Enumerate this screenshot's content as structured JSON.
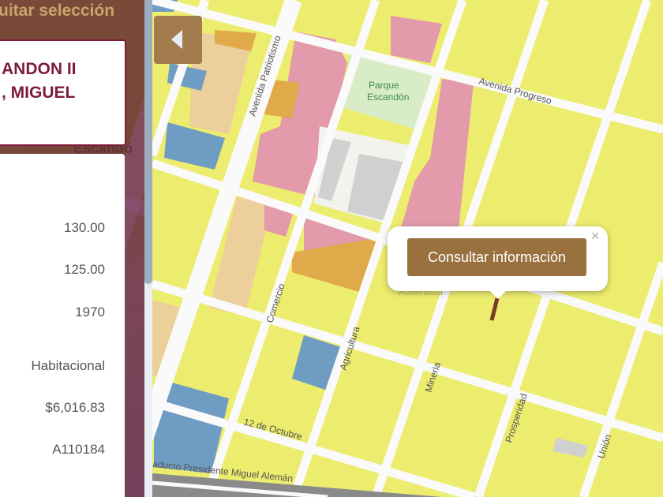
{
  "sidebar": {
    "quit_selection": "uitar selección",
    "name_line1": "ANDON II",
    "name_line2": ", MIGUEL",
    "bg_label": "Escandó",
    "values": [
      "130.00",
      "125.00",
      "1970",
      "Habitacional",
      "$6,016.83",
      "A110184"
    ]
  },
  "map": {
    "labels": {
      "patriotismo": "Avenida Patriotismo",
      "parque1": "Parque",
      "parque2": "Escandón",
      "progreso": "Avenida Progreso",
      "comercio": "Comercio",
      "agricultura": "Agricultura",
      "mineria": "Mineria",
      "prosperidad": "Prosperidad",
      "union": "Unión",
      "octubre": "12 de Octubre",
      "viaducto": "aducto Presidente Miguel Alemán",
      "adventista": "Adventista"
    },
    "colors": {
      "residential": "#ecec6e",
      "commercial": "#e39aaa",
      "mixed": "#e0a94a",
      "equipment": "#6f9cc3",
      "tan": "#eccf9a",
      "park": "#d8ecc8",
      "grey": "#d0d0d0"
    }
  },
  "popup": {
    "button_label": "Consultar información",
    "close": "×"
  }
}
